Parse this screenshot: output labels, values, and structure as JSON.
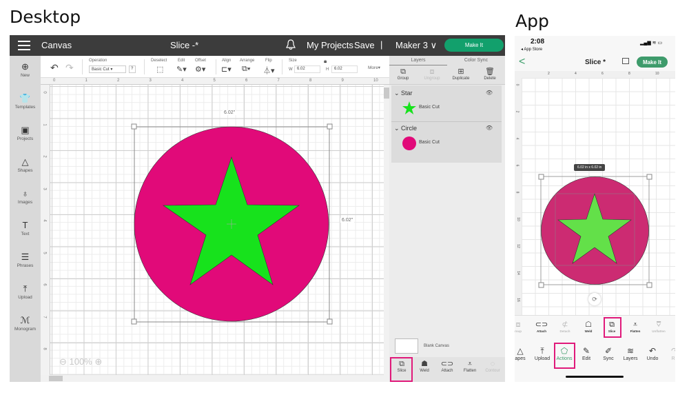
{
  "headings": {
    "desktop": "Desktop",
    "app": "App"
  },
  "desktop": {
    "topbar": {
      "section": "Canvas",
      "title": "Slice -*",
      "my_projects": "My Projects",
      "save": "Save",
      "separator": "|",
      "machine": "Maker 3 ∨",
      "make_it": "Make It"
    },
    "leftnav": [
      {
        "label": "New",
        "icon": "⊕"
      },
      {
        "label": "Templates",
        "icon": "👕"
      },
      {
        "label": "Projects",
        "icon": "▣"
      },
      {
        "label": "Shapes",
        "icon": "△"
      },
      {
        "label": "Images",
        "icon": "♁"
      },
      {
        "label": "Text",
        "icon": "T"
      },
      {
        "label": "Phrases",
        "icon": "☰"
      },
      {
        "label": "Upload",
        "icon": "⤒"
      },
      {
        "label": "Monogram",
        "icon": "ℳ"
      }
    ],
    "toolbar": {
      "undo": "↶",
      "redo": "↷",
      "operation_label": "Operation",
      "operation_value": "Basic Cut ▾",
      "help": "?",
      "deselect": "Deselect",
      "edit": "Edit",
      "offset": "Offset",
      "align": "Align",
      "arrange": "Arrange",
      "flip": "Flip",
      "size": "Size",
      "w_label": "W",
      "w_value": "6.02",
      "h_label": "H",
      "h_value": "6.02",
      "more": "More▾"
    },
    "ruler_top": [
      "0",
      "1",
      "2",
      "3",
      "4",
      "5",
      "6",
      "7",
      "8",
      "9",
      "10"
    ],
    "ruler_left": [
      "0",
      "1",
      "2",
      "3",
      "4",
      "5",
      "6",
      "7",
      "8"
    ],
    "dim_width": "6.02\"",
    "dim_height": "6.02\"",
    "zoom": "⊖ 100% ⊕",
    "colors": {
      "circle": "#e10a79",
      "star": "#17e21c",
      "accent": "#12a06c",
      "highlight": "#e0197a"
    },
    "panel": {
      "tabs": [
        "Layers",
        "Color Sync"
      ],
      "actions": [
        {
          "label": "Group",
          "icon": "⧉",
          "enabled": true
        },
        {
          "label": "Ungroup",
          "icon": "⧈",
          "enabled": false
        },
        {
          "label": "Duplicate",
          "icon": "⊞",
          "enabled": true
        },
        {
          "label": "Delete",
          "icon": "🗑",
          "enabled": true
        }
      ],
      "layers": [
        {
          "name": "Star",
          "operation": "Basic Cut",
          "color": "#17e21c",
          "visible_icon": "👁"
        },
        {
          "name": "Circle",
          "operation": "Basic Cut",
          "color": "#e10a79",
          "visible_icon": "👁"
        }
      ],
      "blank_canvas": "Blank Canvas",
      "bottom_actions": [
        {
          "label": "Slice",
          "icon": "⧉",
          "enabled": true,
          "highlighted": true
        },
        {
          "label": "Weld",
          "icon": "☗",
          "enabled": true
        },
        {
          "label": "Attach",
          "icon": "⊂⊃",
          "enabled": true
        },
        {
          "label": "Flatten",
          "icon": "⩡",
          "enabled": true
        },
        {
          "label": "Contour",
          "icon": "◌",
          "enabled": false
        }
      ]
    }
  },
  "app": {
    "status": {
      "time": "2:08",
      "back_app": "◂ App Store",
      "icons": "▂▄▆ ≋ ▭"
    },
    "nav": {
      "back": "<",
      "title": "Slice *",
      "make_it": "Make It"
    },
    "ruler_top": [
      "2",
      "4",
      "6",
      "8",
      "10"
    ],
    "ruler_left": [
      "0",
      "2",
      "4",
      "6",
      "8",
      "10",
      "12",
      "14",
      "16"
    ],
    "size_badge": "6.02 in x 6.02 in",
    "colors": {
      "circle": "#cc2b72",
      "star": "#63e049",
      "accent": "#3e9b6b"
    },
    "row1": [
      {
        "label": "roup",
        "icon": "⧈",
        "enabled": false
      },
      {
        "label": "Attach",
        "icon": "⊂⊃",
        "enabled": true
      },
      {
        "label": "Detach",
        "icon": "⊄",
        "enabled": false
      },
      {
        "label": "Weld",
        "icon": "☖",
        "enabled": true
      },
      {
        "label": "Slice",
        "icon": "⧉",
        "enabled": true,
        "highlighted": true
      },
      {
        "label": "Flatten",
        "icon": "⩡",
        "enabled": true
      },
      {
        "label": "Unflatten",
        "icon": "⩢",
        "enabled": false
      }
    ],
    "row2": [
      {
        "label": "apes",
        "icon": "△"
      },
      {
        "label": "Upload",
        "icon": "⤒"
      },
      {
        "label": "Actions",
        "icon": "⬠",
        "active": true,
        "highlighted": true
      },
      {
        "label": "Edit",
        "icon": "✎"
      },
      {
        "label": "Sync",
        "icon": "✐"
      },
      {
        "label": "Layers",
        "icon": "≋"
      },
      {
        "label": "Undo",
        "icon": "↶"
      },
      {
        "label": "Re",
        "icon": "↷",
        "enabled": false
      }
    ]
  }
}
